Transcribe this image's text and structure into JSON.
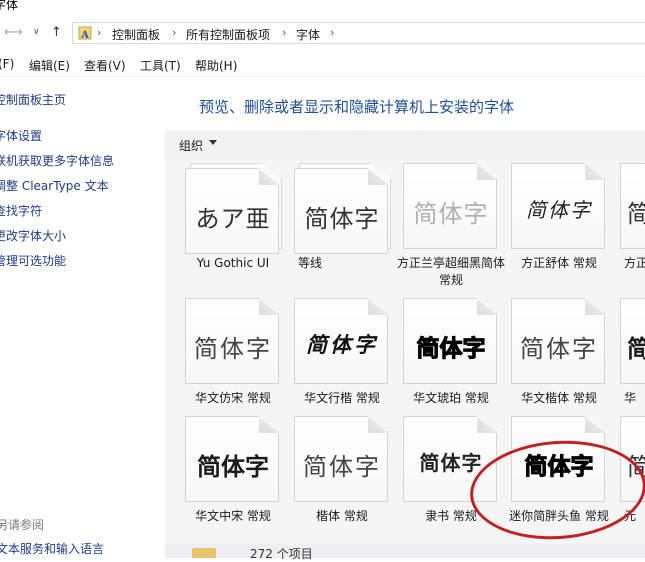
{
  "window": {
    "title": "字体"
  },
  "address": {
    "crumbs": [
      "控制面板",
      "所有控制面板项",
      "字体"
    ],
    "icon": "fonts-folder-icon"
  },
  "menu": [
    "(F)",
    "编辑(E)",
    "查看(V)",
    "工具(T)",
    "帮助(H)"
  ],
  "left_pane": {
    "links": [
      "控制面板主页",
      "字体设置",
      "联机获取更多字体信息",
      "调整 ClearType 文本",
      "查找字符",
      "更改字体大小",
      "管理可选功能"
    ],
    "see_also": "另请参阅",
    "bottom_link": "文本服务和输入语言"
  },
  "heading": "预览、删除或者显示和隐藏计算机上安装的字体",
  "toolbar": {
    "organize": "组织"
  },
  "fonts": [
    {
      "name": "Yu Gothic UI",
      "sample": "あア亜",
      "style": "light",
      "stacked": true
    },
    {
      "name": "等线",
      "sample": "简体字",
      "style": "normal",
      "stacked": true
    },
    {
      "name": "方正兰亭超细黑简体 常规",
      "sample": "简体字",
      "style": "thin",
      "stacked": false
    },
    {
      "name": "方正舒体 常规",
      "sample": "简体字",
      "style": "script",
      "stacked": false
    },
    {
      "name": "方正",
      "sample": "简",
      "style": "normal",
      "stacked": false
    },
    {
      "name": "华文仿宋 常规",
      "sample": "简体字",
      "style": "song",
      "stacked": false
    },
    {
      "name": "华文行楷 常规",
      "sample": "简体字",
      "style": "brush",
      "stacked": false
    },
    {
      "name": "华文琥珀 常规",
      "sample": "简体字",
      "style": "heavy",
      "stacked": false
    },
    {
      "name": "华文楷体 常规",
      "sample": "简体字",
      "style": "song",
      "stacked": false
    },
    {
      "name": "华",
      "sample": "简",
      "style": "bold",
      "stacked": false
    },
    {
      "name": "华文中宋 常规",
      "sample": "简体字",
      "style": "bold",
      "stacked": false
    },
    {
      "name": "楷体 常规",
      "sample": "简体字",
      "style": "song",
      "stacked": false
    },
    {
      "name": "隶书 常规",
      "sample": "简体字",
      "style": "lishu",
      "stacked": false
    },
    {
      "name": "迷你简胖头鱼 常规",
      "sample": "简体字",
      "style": "heavy",
      "stacked": false
    },
    {
      "name": "元",
      "sample": "简",
      "style": "normal",
      "stacked": false
    }
  ],
  "status": {
    "count": "272 个项目"
  },
  "highlight_color": "#c42020"
}
